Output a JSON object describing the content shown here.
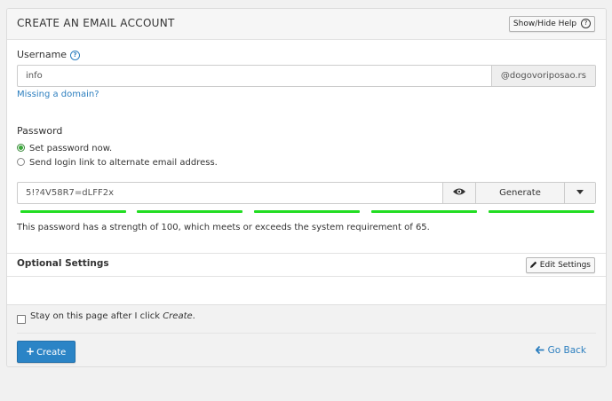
{
  "header": {
    "title": "CREATE AN EMAIL ACCOUNT",
    "help_button": "Show/Hide Help"
  },
  "username": {
    "label": "Username",
    "value": "info",
    "domain": "@dogovoriposao.rs",
    "missing_domain_link": "Missing a domain?"
  },
  "password": {
    "label": "Password",
    "options": [
      {
        "label": "Set password now.",
        "checked": true
      },
      {
        "label": "Send login link to alternate email address.",
        "checked": false
      }
    ],
    "value": "5!?4V58R7=dLFF2x",
    "generate_label": "Generate",
    "strength_segments_filled": 5,
    "strength_color": "#22dd22",
    "strength_message": "This password has a strength of 100, which meets or exceeds the system requirement of 65."
  },
  "optional": {
    "title": "Optional Settings",
    "edit_button": "Edit Settings"
  },
  "footer": {
    "stay_prefix": "Stay on this page after I click ",
    "stay_em": "Create",
    "stay_suffix": ".",
    "stay_checked": false,
    "create_label": "Create",
    "go_back_label": "Go Back"
  },
  "icons": {
    "help": "question-circle-icon",
    "info": "info-circle-icon",
    "eye": "eye-icon",
    "caret": "caret-down-icon",
    "pencil": "pencil-icon",
    "plus": "plus-icon",
    "arrow_left": "arrow-left-icon"
  },
  "colors": {
    "accent": "#2b84c6",
    "link": "#2d7fbf",
    "strength": "#22dd22"
  }
}
